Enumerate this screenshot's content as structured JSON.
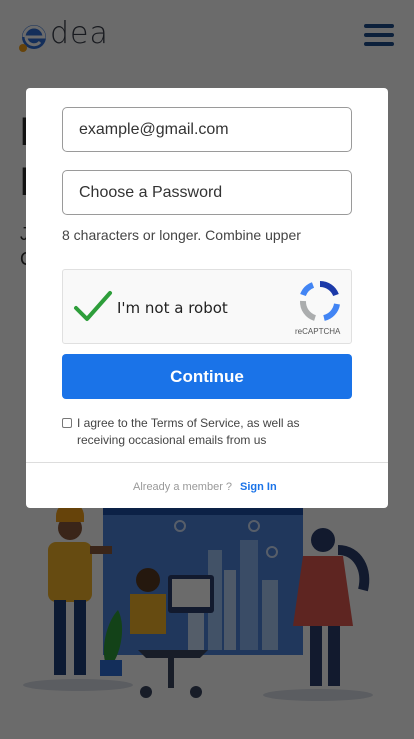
{
  "header": {
    "logo_text": "dea",
    "menu_icon": "hamburger-icon"
  },
  "background": {
    "heading_line1": "I",
    "heading_line2": "I",
    "sub_line1": "J",
    "sub_line2": "C"
  },
  "signup": {
    "email_placeholder": "example@gmail.com",
    "password_placeholder": "Choose a Password",
    "password_hint": "8 characters or longer. Combine upper",
    "captcha_label": "I'm not a robot",
    "captcha_brand": "reCAPTCHA",
    "captcha_checked": true,
    "continue_label": "Continue",
    "agree_text": "I agree to the Terms of Service, as well as receiving occasional emails from us",
    "member_text": "Already a member ?",
    "signin_label": "Sign In"
  },
  "colors": {
    "accent": "#1a73e8",
    "check_green": "#2e9e3b",
    "menu_blue": "#1e4e8c"
  }
}
